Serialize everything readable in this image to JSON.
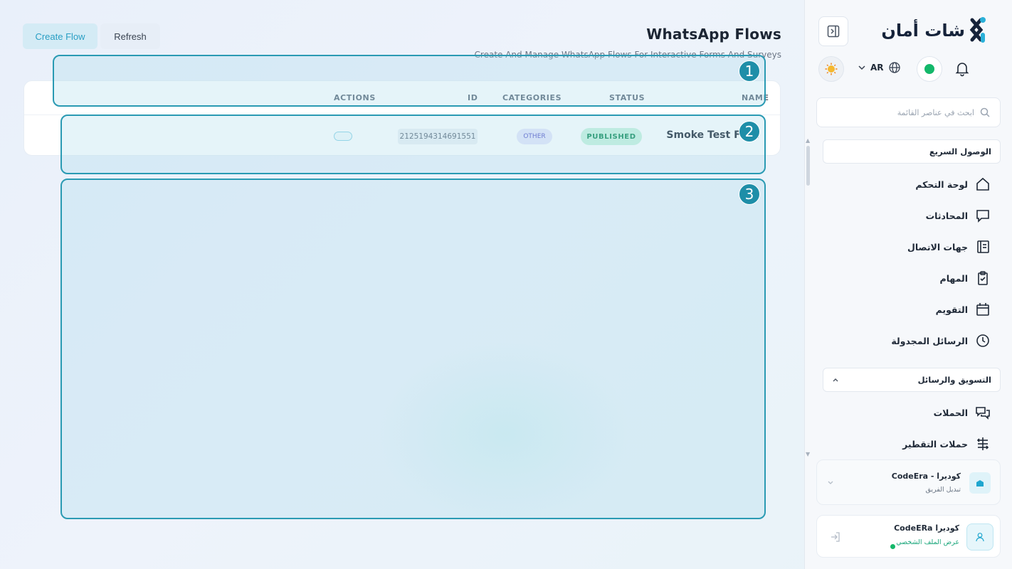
{
  "main": {
    "buttons": {
      "create": "Create Flow",
      "refresh": "Refresh"
    },
    "title": "WhatsApp Flows",
    "subtitle": "Create And Manage WhatsApp Flows For Interactive Forms And Surveys",
    "table": {
      "columns": [
        "ACTIONS",
        "ID",
        "CATEGORIES",
        "STATUS",
        "NAME"
      ],
      "rows": [
        {
          "name": "Smoke Test Flow",
          "status": "PUBLISHED",
          "category": "OTHER",
          "id": "2125194314691551"
        }
      ]
    },
    "regions": [
      "1",
      "2",
      "3"
    ]
  },
  "sidebar": {
    "logo_text": "شات أمان",
    "language": "AR",
    "search_placeholder": "ابحث في عناصر القائمة",
    "quick_access": "الوصول السريع",
    "items": [
      {
        "label": "لوحة التحكم",
        "icon": "home-icon"
      },
      {
        "label": "المحادثات",
        "icon": "chat-icon"
      },
      {
        "label": "جهات الاتصال",
        "icon": "contacts-book-icon"
      },
      {
        "label": "المهام",
        "icon": "clipboard-check-icon"
      },
      {
        "label": "التقويم",
        "icon": "calendar-icon"
      },
      {
        "label": "الرسائل المجدولة",
        "icon": "clock-icon"
      }
    ],
    "marketing_section": "التسويق والرسائل",
    "marketing_items": [
      {
        "label": "الحملات",
        "icon": "campaigns-icon"
      },
      {
        "label": "حملات التقطير",
        "icon": "drip-icon"
      }
    ],
    "team": {
      "name": "كوديرا - CodeEra",
      "sub": "تبديل الفريق"
    },
    "profile": {
      "name": "كوديرا CodeERa",
      "sub": "عرض الملف الشخصي"
    }
  },
  "colors": {
    "accent": "#2a9fc4",
    "published": "#0e8a57",
    "online": "#14b86a"
  }
}
